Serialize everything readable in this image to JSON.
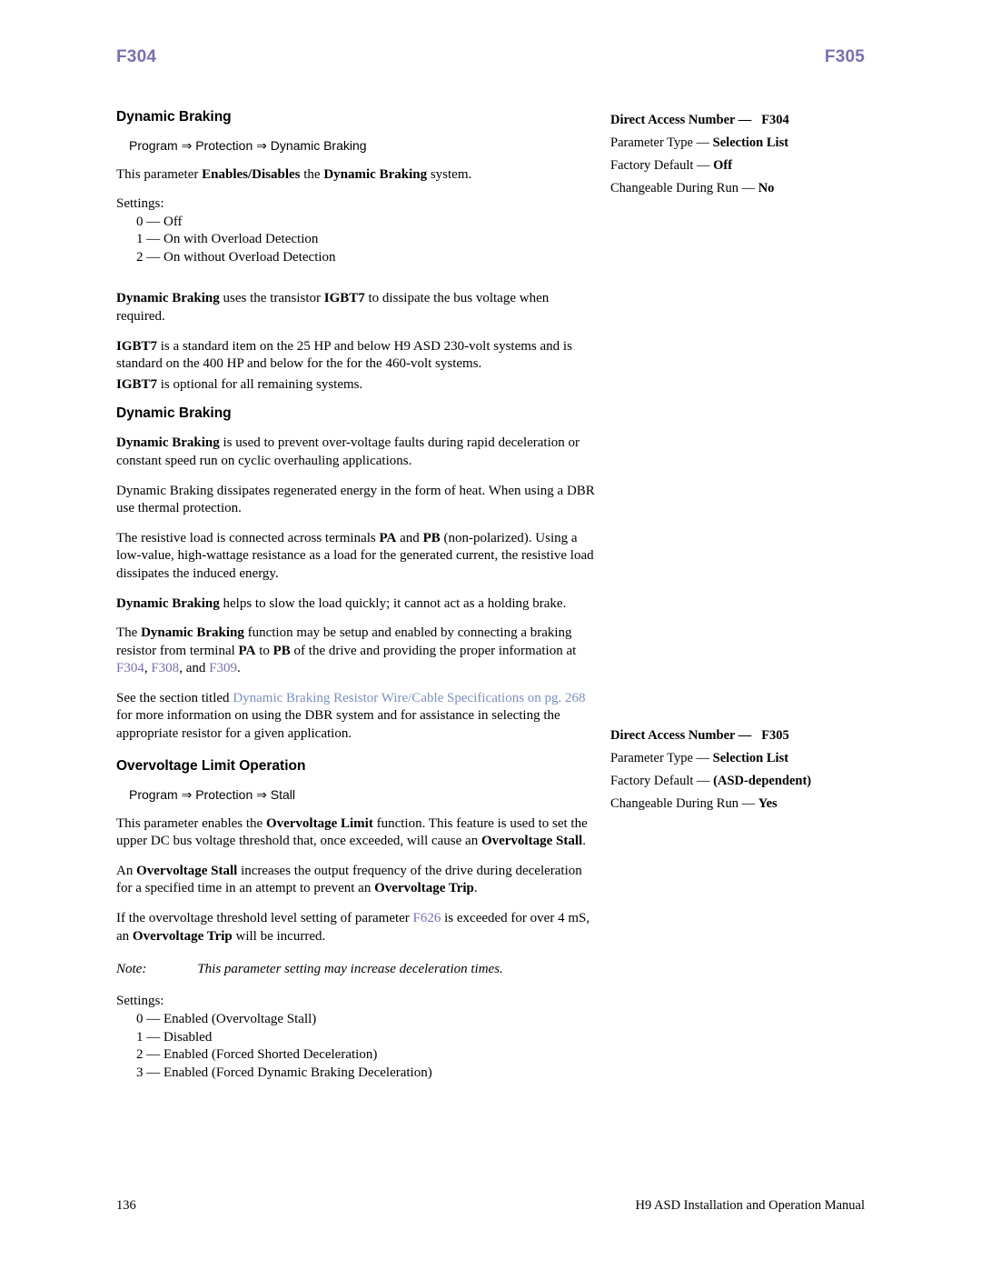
{
  "header": {
    "left_code": "F304",
    "right_code": "F305"
  },
  "left_column": {
    "section1": {
      "title": "Dynamic Braking",
      "path": "Program ⇒ Protection ⇒ Dynamic Braking",
      "intro_1": "This parameter ",
      "intro_2": "Enables/Disables",
      "intro_3": " the ",
      "intro_4": "Dynamic Braking",
      "intro_5": " system.",
      "settings_label": "Settings:",
      "settings": [
        "0 — Off",
        "1 — On with Overload Detection",
        "2 — On without Overload Detection"
      ],
      "para1_b": "Dynamic Braking",
      "para1_t1": " uses the transistor ",
      "para1_b2": "IGBT7",
      "para1_t2": " to dissipate the bus voltage when required.",
      "para2_b": "IGBT7",
      "para2_t": " is a standard item on the 25 HP and below H9 ASD 230-volt systems and is standard on the 400 HP and below for the for the 460-volt systems.",
      "para3_b": "IGBT7",
      "para3_t": " is optional for all remaining systems."
    },
    "section2": {
      "title": "Dynamic Braking",
      "p1_b": "Dynamic Braking",
      "p1_t": " is used to prevent over-voltage faults during rapid deceleration or constant speed run on cyclic overhauling applications.",
      "p2": "Dynamic Braking dissipates regenerated energy in the form of heat. When using a DBR use thermal protection.",
      "p3_t1": "The resistive load is connected across terminals ",
      "p3_b1": "PA",
      "p3_t2": " and ",
      "p3_b2": "PB",
      "p3_t3": " (non-polarized). Using a low-value, high-wattage resistance as a load for the generated current, the resistive load dissipates the induced energy.",
      "p4_b": "Dynamic Braking",
      "p4_t": " helps to slow the load quickly; it cannot act as a holding brake.",
      "p5_t1": "The ",
      "p5_b1": "Dynamic Braking",
      "p5_t2": " function may be setup and enabled by connecting a braking resistor from terminal ",
      "p5_b2": "PA",
      "p5_t3": " to ",
      "p5_b3": "PB",
      "p5_t4": " of the drive and providing the proper information at ",
      "p5_l1": "F304",
      "p5_t5": ", ",
      "p5_l2": "F308",
      "p5_t6": ", and ",
      "p5_l3": "F309",
      "p5_t7": ".",
      "p6_t1": "See the section titled ",
      "p6_l1": "Dynamic Braking Resistor Wire/Cable Specifications on pg. 268",
      "p6_t2": " for more information on using the DBR system and for assistance in selecting the appropriate resistor for a given application."
    },
    "section3": {
      "title": "Overvoltage Limit Operation",
      "path": "Program ⇒ Protection ⇒ Stall",
      "p1_t1": "This parameter enables the ",
      "p1_b1": "Overvoltage Limit",
      "p1_t2": " function. This feature is used to set the upper DC bus voltage threshold that, once exceeded, will cause an ",
      "p1_b2": "Overvoltage Stall",
      "p1_t3": ".",
      "p2_t1": "An ",
      "p2_b1": "Overvoltage Stall",
      "p2_t2": " increases the output frequency of the drive during deceleration for a specified time in an attempt to prevent an ",
      "p2_b2": "Overvoltage Trip",
      "p2_t3": ".",
      "p3_t1": "If the overvoltage threshold level setting of parameter ",
      "p3_l1": "F626",
      "p3_t2": " is exceeded for over 4 mS, an ",
      "p3_b1": "Overvoltage Trip",
      "p3_t3": " will be incurred.",
      "note_label": "Note:",
      "note_text": "This parameter setting may increase deceleration times.",
      "settings_label": "Settings:",
      "settings": [
        "0 — Enabled (Overvoltage Stall)",
        "1 — Disabled",
        "2 — Enabled (Forced Shorted Deceleration)",
        "3 — Enabled (Forced Dynamic Braking Deceleration)"
      ]
    }
  },
  "right_column": {
    "block1": {
      "dan_label": "Direct Access Number —",
      "dan_value": "F304",
      "ptype_label": "Parameter Type — ",
      "ptype_value": "Selection List",
      "fdef_label": "Factory Default — ",
      "fdef_value": "Off",
      "cdr_label": "Changeable During Run — ",
      "cdr_value": "No"
    },
    "block2": {
      "dan_label": "Direct Access Number —",
      "dan_value": "F305",
      "ptype_label": "Parameter Type — ",
      "ptype_value": "Selection List",
      "fdef_label": "Factory Default — ",
      "fdef_value": "(ASD-dependent)",
      "cdr_label": "Changeable During Run — ",
      "cdr_value": "Yes"
    }
  },
  "footer": {
    "page_number": "136",
    "manual_title": "H9 ASD Installation and Operation Manual"
  },
  "colors": {
    "accent_purple": "#7b6fb0",
    "link_blue": "#7b8fc0"
  }
}
